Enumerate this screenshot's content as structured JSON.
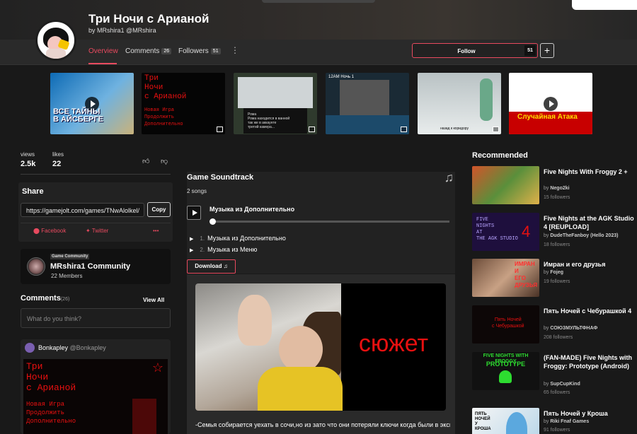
{
  "game": {
    "title": "Три Ночи с Арианой",
    "byline": "by MRshira1 @MRshira"
  },
  "nav": {
    "tabs": [
      {
        "label": "Overview"
      },
      {
        "label": "Comments",
        "count": "26"
      },
      {
        "label": "Followers",
        "count": "51"
      }
    ],
    "more": "⋮",
    "follow_label": "Follow",
    "follow_count": "51",
    "add_label": "+"
  },
  "media": {
    "thumbs": [
      {
        "caption_line1": "ВСЕ ТАЙНЫ",
        "caption_line2": "В АЙСБЕРГЕ",
        "video": true
      },
      {
        "title_lines": "Три\nНочи\nс Арианой",
        "sub_lines": "Новая Игра\nПродолжить\nДополнительно"
      },
      {
        "box_title": "Рома",
        "box_text": "Рома находится в ванной\nтак же в аккаунте\nтретий камера..."
      },
      {
        "label": "12AM Ночь 1"
      },
      {
        "label": "назад к коридору"
      },
      {
        "caption": "Случайная Атака",
        "video": true
      }
    ]
  },
  "stats": {
    "views_label": "views",
    "views_value": "2.5k",
    "likes_label": "likes",
    "likes_value": "22",
    "like_icon": "thumbs-up-icon",
    "dislike_icon": "thumbs-down-icon"
  },
  "share": {
    "heading": "Share",
    "url": "https://gamejolt.com/games/TNwAlolkel/",
    "copy_label": "Copy",
    "facebook_label": "Facebook",
    "twitter_label": "Twitter",
    "more_label": "•••"
  },
  "community": {
    "badge": "Game Community",
    "name": "MRshira1 Community",
    "members": "22 Members"
  },
  "comments": {
    "heading": "Comments",
    "count": "(26)",
    "view_all": "View All",
    "placeholder": "What do you think?",
    "first": {
      "user": "Bonkapley",
      "handle": "@Bonkapley",
      "image_title": "Три\nНочи\nс Арианой",
      "image_sub": "Новая Игра\nПродолжить\nДополнительно"
    }
  },
  "soundtrack": {
    "heading": "Game Soundtrack",
    "count": "2 songs",
    "current": "Музыка из Дополнительно",
    "tracks": [
      {
        "num": "1.",
        "title": "Музыка из Дополнительно"
      },
      {
        "num": "2.",
        "title": "Музыка из Меню"
      }
    ],
    "download_label": "Download ♫"
  },
  "description": {
    "image_word": "сюжет",
    "text": "-Семья собирается уехать в сочи,но из зато что они потеряли ключи когда были в экскурсию они решили сделать обьявление о работе охраны их квартиры"
  },
  "recommended": {
    "heading": "Recommended",
    "items": [
      {
        "title": "Five Nights With Froggy 2 +",
        "by": "by",
        "author": "Nego2ki",
        "followers": "15 followers"
      },
      {
        "title": "Five Nights at the AGK Studio 4 [REUPLOAD]",
        "by": "by",
        "author": "DudeTheFanboy (Hello 2023)",
        "followers": "18 followers",
        "thumb_text": "FIVE\nNIGHTS\nAT\nTHE AGK STUDIO",
        "thumb_num": "4"
      },
      {
        "title": "Имран и его друзья",
        "by": "by",
        "author": "Fojeg",
        "followers": "19 followers",
        "thumb_text": "ИМРАН\nИ\nЕГО\nДРУЗЬЯ"
      },
      {
        "title": "Пять Ночей с Чебурашкой 4",
        "by": "by",
        "author": "СОЮЗМУЛЬТФНАФ",
        "followers": "208 followers",
        "thumb_text": "Пять Ночей\nс Чебурашкой"
      },
      {
        "title": "(FAN-MADE) Five Nights with Froggy: Prototype (Android)",
        "by": "by",
        "author": "SupCupKind",
        "followers": "65 followers",
        "thumb_text": "FIVE NIGHTS WITH FROGGY",
        "thumb_text2": "PROTOTYPE"
      },
      {
        "title": "Пять Ночей у Кроша",
        "by": "by",
        "author": "Riki Fnaf Games",
        "followers": "91 followers",
        "thumb_text": "ПЯТЬ\nНОЧЕЙ\nУ\nКРОША"
      }
    ]
  },
  "colors": {
    "accent": "#e84a5f",
    "bg": "#191919",
    "card": "#222222"
  }
}
